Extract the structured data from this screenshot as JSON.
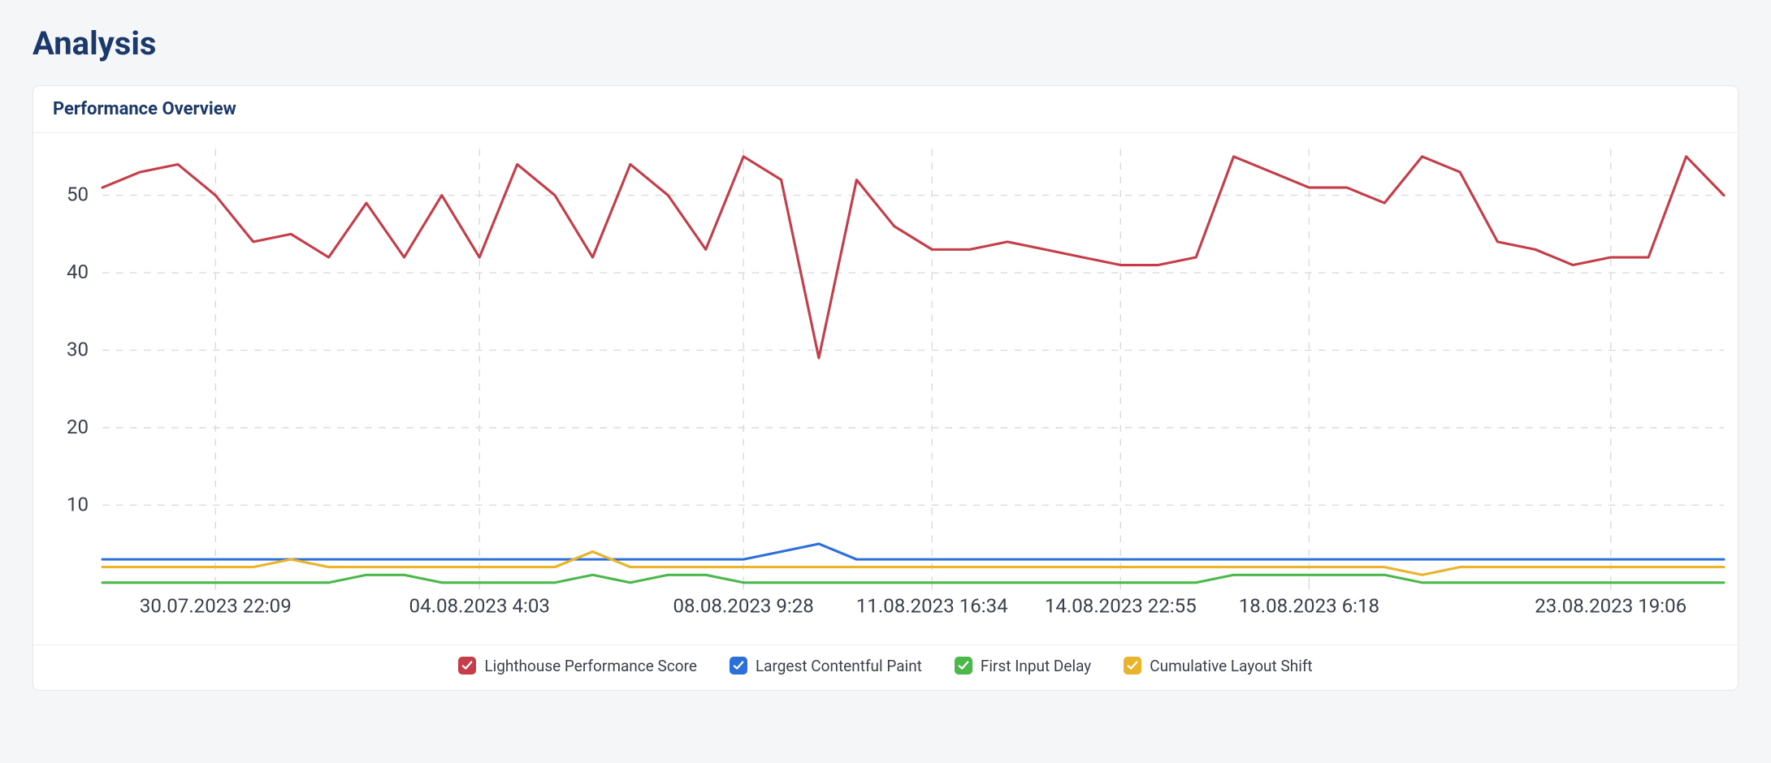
{
  "page": {
    "title": "Analysis"
  },
  "card": {
    "title": "Performance Overview"
  },
  "legend": [
    {
      "label": "Lighthouse Performance Score",
      "color": "#c53d48"
    },
    {
      "label": "Largest Contentful Paint",
      "color": "#2b6fd9"
    },
    {
      "label": "First Input Delay",
      "color": "#4bb84b"
    },
    {
      "label": "Cumulative Layout Shift",
      "color": "#e9b32a"
    }
  ],
  "chart_data": {
    "type": "line",
    "title": "Performance Overview",
    "xlabel": "",
    "ylabel": "",
    "ylim": [
      0,
      56
    ],
    "y_ticks": [
      10,
      20,
      30,
      40,
      50
    ],
    "x_tick_indices": [
      3,
      10,
      17,
      22,
      27,
      32,
      40
    ],
    "x_tick_labels": [
      "30.07.2023 22:09",
      "04.08.2023 4:03",
      "08.08.2023 9:28",
      "11.08.2023 16:34",
      "14.08.2023 22:55",
      "18.08.2023 6:18",
      "23.08.2023 19:06"
    ],
    "n_points": 44,
    "series": [
      {
        "name": "Lighthouse Performance Score",
        "color": "#c53d48",
        "values": [
          51,
          53,
          54,
          50,
          44,
          45,
          42,
          49,
          42,
          50,
          42,
          54,
          50,
          42,
          54,
          50,
          43,
          55,
          52,
          29,
          52,
          46,
          43,
          43,
          44,
          43,
          42,
          41,
          41,
          42,
          55,
          53,
          51,
          51,
          49,
          55,
          53,
          44,
          43,
          41,
          42,
          42,
          55,
          50
        ]
      },
      {
        "name": "Largest Contentful Paint",
        "color": "#2b6fd9",
        "values": [
          3,
          3,
          3,
          3,
          3,
          3,
          3,
          3,
          3,
          3,
          3,
          3,
          3,
          3,
          3,
          3,
          3,
          3,
          4,
          5,
          3,
          3,
          3,
          3,
          3,
          3,
          3,
          3,
          3,
          3,
          3,
          3,
          3,
          3,
          3,
          3,
          3,
          3,
          3,
          3,
          3,
          3,
          3,
          3
        ]
      },
      {
        "name": "First Input Delay",
        "color": "#4bb84b",
        "values": [
          0,
          0,
          0,
          0,
          0,
          0,
          0,
          1,
          1,
          0,
          0,
          0,
          0,
          1,
          0,
          1,
          1,
          0,
          0,
          0,
          0,
          0,
          0,
          0,
          0,
          0,
          0,
          0,
          0,
          0,
          1,
          1,
          1,
          1,
          1,
          0,
          0,
          0,
          0,
          0,
          0,
          0,
          0,
          0
        ]
      },
      {
        "name": "Cumulative Layout Shift",
        "color": "#e9b32a",
        "values": [
          2,
          2,
          2,
          2,
          2,
          3,
          2,
          2,
          2,
          2,
          2,
          2,
          2,
          4,
          2,
          2,
          2,
          2,
          2,
          2,
          2,
          2,
          2,
          2,
          2,
          2,
          2,
          2,
          2,
          2,
          2,
          2,
          2,
          2,
          2,
          1,
          2,
          2,
          2,
          2,
          2,
          2,
          2,
          2
        ]
      }
    ]
  }
}
